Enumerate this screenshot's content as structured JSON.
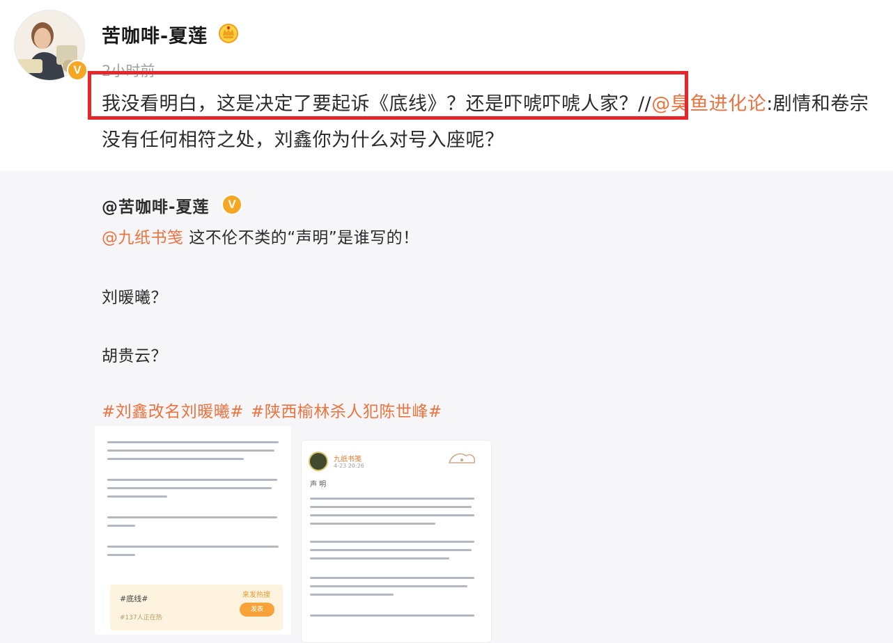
{
  "post": {
    "author": "苦咖啡-夏莲",
    "time": "2小时前",
    "text_main": "我没看明白，这是决定了要起诉《底线》？还是吓唬吓唬人家？//",
    "text_mention": "@臭鱼进化论",
    "text_rest": ":剧情和卷宗没有任何相符之处，刘鑫你为什么对号入座呢？",
    "verified_badge": "V"
  },
  "retweet": {
    "author": "@苦咖啡-夏莲",
    "verified_badge": "V",
    "mention": "@九纸书笺",
    "line1_rest": " 这不伦不类的“声明”是谁写的！",
    "line2": "刘暖曦？",
    "line3": "胡贵云？",
    "hashtags": [
      "#刘鑫改名刘暖曦#",
      "#陕西榆林杀人犯陈世峰#"
    ]
  },
  "images": {
    "img1": {
      "card_tag": "#底线#",
      "card_sub": "#137人正在热",
      "card_link": "来发热搜",
      "card_button": "发表"
    },
    "img2": {
      "publisher": "九纸书笺",
      "date": "4-23 20:26",
      "title": "声 明"
    }
  },
  "colors": {
    "accent_orange": "#eb7340",
    "highlight_red": "#e5262b",
    "verified_gold": "#f5a623",
    "retweet_bg": "#f6f6f8"
  }
}
